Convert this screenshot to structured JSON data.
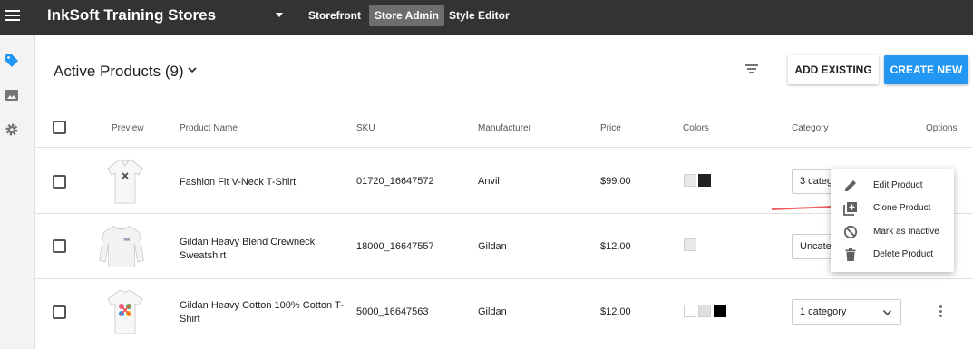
{
  "topbar": {
    "store_name": "InkSoft Training Stores",
    "tabs": [
      {
        "label": "Storefront"
      },
      {
        "label": "Store Admin"
      },
      {
        "label": "Style Editor"
      }
    ]
  },
  "header": {
    "title": "Active Products (9)",
    "add_existing_label": "ADD EXISTING",
    "create_new_label": "CREATE NEW"
  },
  "table": {
    "columns": [
      "Preview",
      "Product Name",
      "SKU",
      "Manufacturer",
      "Price",
      "Colors",
      "Category",
      "Options"
    ],
    "rows": [
      {
        "name": "Fashion Fit V-Neck T-Shirt",
        "sku": "01720_16647572",
        "manufacturer": "Anvil",
        "price": "$99.00",
        "category": "3 categ",
        "colors": [
          "#e8e8e8",
          "#222222"
        ]
      },
      {
        "name": "Gildan Heavy Blend Crewneck Sweatshirt",
        "sku": "18000_16647557",
        "manufacturer": "Gildan",
        "price": "$12.00",
        "category": "Uncate",
        "colors": [
          "#e8e8e8"
        ]
      },
      {
        "name": "Gildan Heavy Cotton 100% Cotton T-Shirt",
        "sku": "5000_16647563",
        "manufacturer": "Gildan",
        "price": "$12.00",
        "category": "1 category",
        "colors": [
          "#ffffff",
          "#e0e0e0",
          "#000000"
        ]
      }
    ]
  },
  "context_menu": {
    "items": [
      {
        "label": "Edit Product",
        "icon": "pencil-icon"
      },
      {
        "label": "Clone Product",
        "icon": "clone-icon"
      },
      {
        "label": "Mark as Inactive",
        "icon": "block-icon"
      },
      {
        "label": "Delete Product",
        "icon": "trash-icon"
      }
    ]
  },
  "colors": {
    "topbar": "#333333",
    "accent": "#2196f3",
    "arrow": "#f05a5a"
  }
}
